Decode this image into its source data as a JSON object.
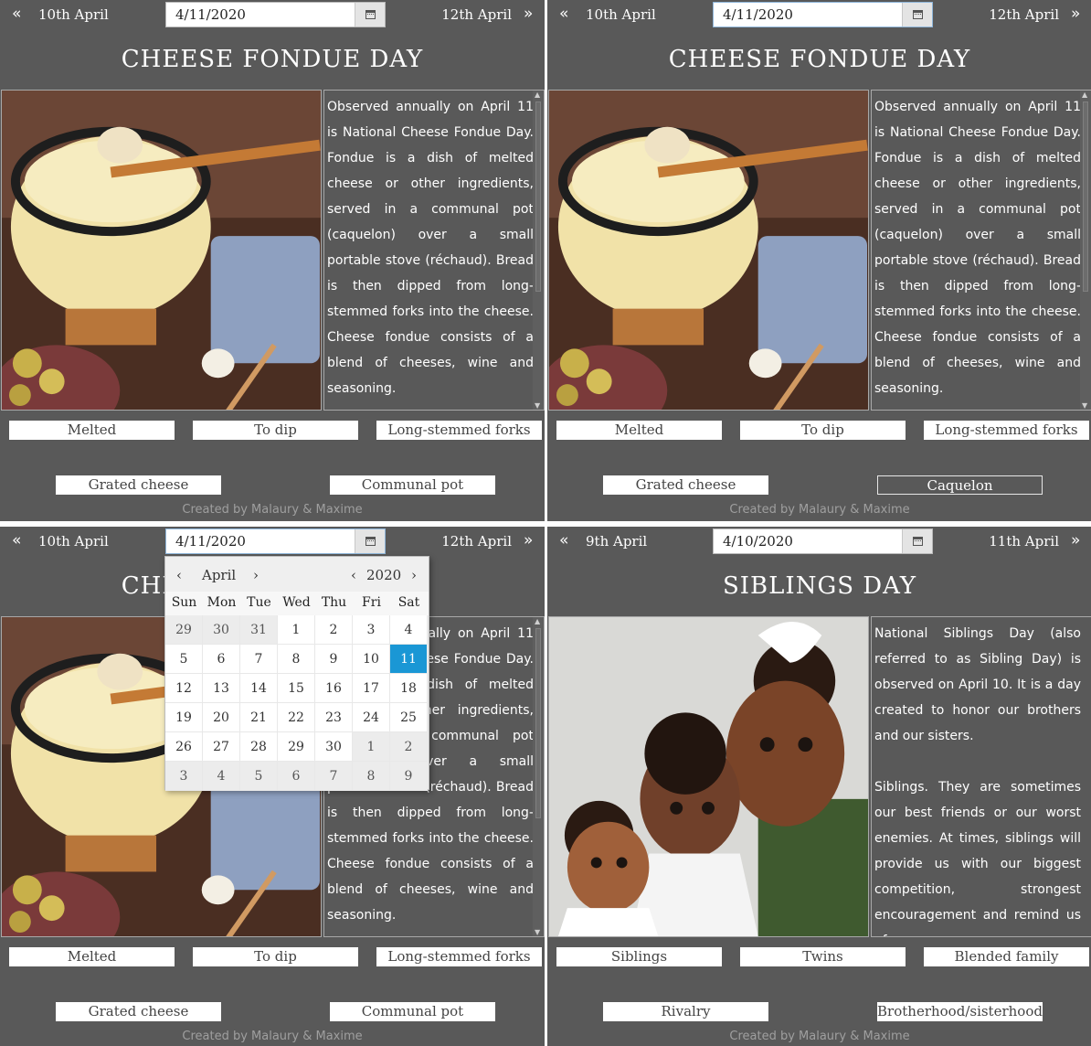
{
  "colors": {
    "panel_bg": "#595959",
    "selected_day": "#1a97d5",
    "tag_bg": "#ffffff"
  },
  "icons": {
    "prev": "double-chevron-left-icon",
    "next": "double-chevron-right-icon",
    "calendar": "calendar-icon"
  },
  "panels": [
    {
      "prev_label": "10th April",
      "next_label": "12th April",
      "date_value": "4/11/2020",
      "title": "CHEESE FONDUE DAY",
      "description": "Observed annually on April 11 is National Cheese Fondue Day. Fondue is a dish of melted cheese or other ingredients, served in a communal pot (caquelon) over a small portable stove (réchaud). Bread is then dipped from long-stemmed forks into the cheese. Cheese fondue consists of a blend of cheeses, wine and seasoning.",
      "tags": [
        "Melted",
        "To dip",
        "Long-stemmed forks",
        "Grated cheese",
        "Communal pot"
      ],
      "credit": "Created by Malaury & Maxime"
    },
    {
      "prev_label": "10th April",
      "next_label": "12th April",
      "date_value": "4/11/2020",
      "title": "CHEESE FONDUE DAY",
      "description": "Observed annually on April 11 is National Cheese Fondue Day. Fondue is a dish of melted cheese or other ingredients, served in a communal pot (caquelon) over a small portable stove (réchaud). Bread is then dipped from long-stemmed forks into the cheese. Cheese fondue consists of a blend of cheeses, wine and seasoning.",
      "tags": [
        "Melted",
        "To dip",
        "Long-stemmed forks",
        "Grated cheese",
        "Caquelon"
      ],
      "credit": "Created by Malaury & Maxime"
    },
    {
      "prev_label": "10th April",
      "next_label": "12th April",
      "date_value": "4/11/2020",
      "title": "CHEESE FONDUE DAY",
      "description": "Observed annually on April 11 is National Cheese Fondue Day. Fondue is a dish of melted cheese or other ingredients, served in a communal pot (caquelon) over a small portable stove (réchaud). Bread is then dipped from long-stemmed forks into the cheese. Cheese fondue consists of a blend of cheeses, wine and seasoning.",
      "tags": [
        "Melted",
        "To dip",
        "Long-stemmed forks",
        "Grated cheese",
        "Communal pot"
      ],
      "credit": "Created by Malaury & Maxime"
    },
    {
      "prev_label": "9th April",
      "next_label": "11th April",
      "date_value": "4/10/2020",
      "title": "SIBLINGS DAY",
      "description": "National Siblings Day (also referred to as Sibling Day) is observed on April 10. It is a day created to honor our brothers and our sisters.\n\nSiblings. They are sometimes our best friends or our worst enemies. At times, siblings will provide us with our biggest competition, strongest encouragement and remind us of",
      "tags": [
        "Siblings",
        "Twins",
        "Blended family",
        "Rivalry",
        "Brotherhood/sisterhood"
      ],
      "credit": "Created by Malaury & Maxime"
    }
  ],
  "calendar": {
    "month": "April",
    "year": "2020",
    "prev": "‹",
    "next": "›",
    "weekdays": [
      "Sun",
      "Mon",
      "Tue",
      "Wed",
      "Thu",
      "Fri",
      "Sat"
    ],
    "selected": "11",
    "weeks": [
      [
        "29",
        "30",
        "31",
        "1",
        "2",
        "3",
        "4"
      ],
      [
        "5",
        "6",
        "7",
        "8",
        "9",
        "10",
        "11"
      ],
      [
        "12",
        "13",
        "14",
        "15",
        "16",
        "17",
        "18"
      ],
      [
        "19",
        "20",
        "21",
        "22",
        "23",
        "24",
        "25"
      ],
      [
        "26",
        "27",
        "28",
        "29",
        "30",
        "1",
        "2"
      ],
      [
        "3",
        "4",
        "5",
        "6",
        "7",
        "8",
        "9"
      ]
    ]
  }
}
